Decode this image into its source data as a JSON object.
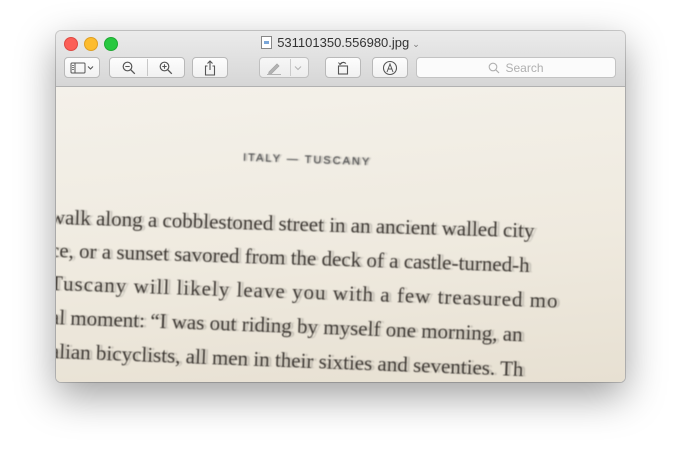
{
  "window": {
    "title": "531101350.556980.jpg"
  },
  "toolbar": {
    "sidebar_icon": "sidebar-icon",
    "zoom_out_icon": "zoom-out-icon",
    "zoom_in_icon": "zoom-in-icon",
    "share_icon": "share-icon",
    "markup_icon": "pen-icon",
    "rotate_icon": "rotate-icon",
    "annotate_icon": "annotate-icon",
    "search_placeholder": "Search"
  },
  "photo": {
    "heading": "ITALY — TUSCANY",
    "lines": [
      "walk along a cobblestoned street in an ancient walled city",
      "ce, or a sunset savored from the deck of a castle-turned-h",
      "Tuscany will likely leave you with a few treasured mo",
      "al moment: “I was out riding by myself one morning, an",
      "alian bicyclists, all men in their sixties and seventies. Th"
    ]
  },
  "colors": {
    "close": "#fc5f57",
    "minimize": "#fdbc2e",
    "maximize": "#28c840"
  }
}
